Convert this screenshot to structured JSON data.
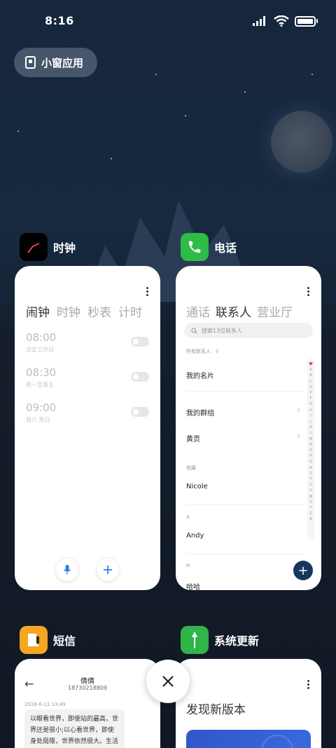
{
  "status_bar": {
    "time": "8:16"
  },
  "floating_window": {
    "label": "小窗应用"
  },
  "apps": {
    "clock": {
      "title": "时钟",
      "tabs": [
        "闹钟",
        "时钟",
        "秒表",
        "计时"
      ],
      "alarms": [
        {
          "time": "08:00",
          "repeat": "法定工作日"
        },
        {
          "time": "08:30",
          "repeat": "周一至周五"
        },
        {
          "time": "09:00",
          "repeat": "周六 周日"
        }
      ]
    },
    "phone": {
      "title": "电话",
      "tabs": [
        "通话",
        "联系人",
        "营业厅"
      ],
      "search_placeholder": "搜索13位联系人",
      "filter_label": "所有联系人",
      "items": {
        "my_card": "我的名片",
        "my_groups": "我的群组",
        "yellow_pages": "黄页",
        "favorites_header": "收藏",
        "contact_nicole": "Nicole",
        "header_a": "A",
        "contact_andy": "Andy",
        "header_h": "H",
        "contact_haha": "哈哈"
      },
      "alphabet": [
        "A",
        "B",
        "C",
        "D",
        "E",
        "F",
        "G",
        "H",
        "I",
        "J",
        "K",
        "L",
        "M",
        "N",
        "O",
        "P",
        "Q",
        "R",
        "S",
        "T",
        "U",
        "V",
        "W",
        "X",
        "Y",
        "Z",
        "#"
      ]
    },
    "messages": {
      "title": "短信",
      "contact_name": "倩倩",
      "contact_number": "18730218809",
      "timestamp": "2016-6-13 13:49",
      "message_text": "以眼看世界，即使站的最高，世界还是很小;以心看世界，即使身处局限，世界依然很大。生活远不完美，需要用心去体会;无需眼在太"
    },
    "update": {
      "title": "系统更新",
      "headline": "发现新版本"
    }
  },
  "colors": {
    "phone_icon": "#2dbc47",
    "messages_icon": "#f5a623",
    "update_icon": "#2fb54a",
    "fab": "#16365d",
    "mic_blue": "#2a7fe8"
  }
}
